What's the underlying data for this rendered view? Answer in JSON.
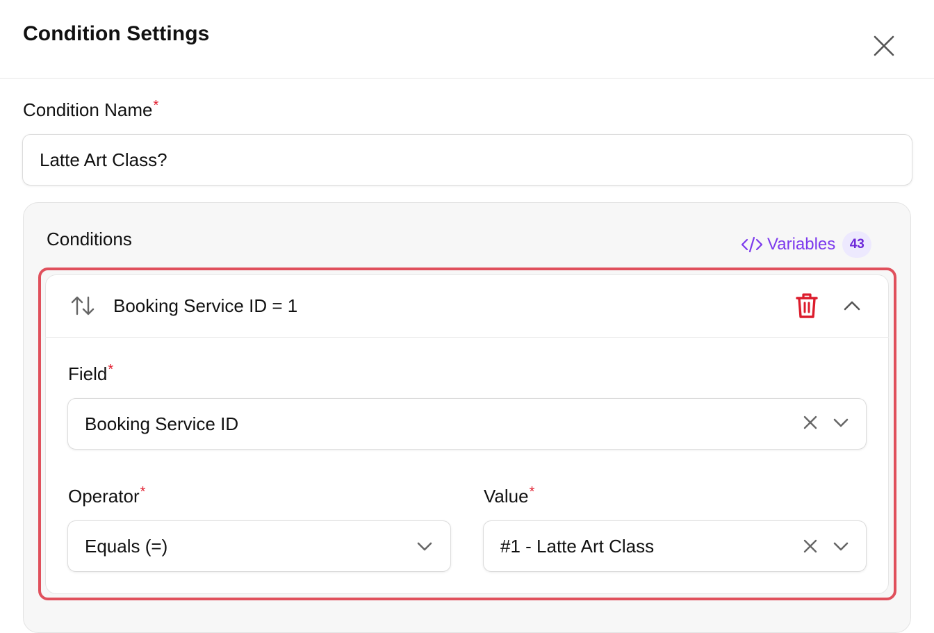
{
  "dialog": {
    "title": "Condition Settings"
  },
  "condition_name": {
    "label": "Condition Name",
    "required_mark": "*",
    "value": "Latte Art Class?"
  },
  "conditions": {
    "label": "Conditions",
    "variables_label": "Variables",
    "variables_count": "43",
    "rule": {
      "summary": "Booking Service ID = 1",
      "field": {
        "label": "Field",
        "required_mark": "*",
        "value": "Booking Service ID"
      },
      "operator": {
        "label": "Operator",
        "required_mark": "*",
        "value": "Equals (=)"
      },
      "value": {
        "label": "Value",
        "required_mark": "*",
        "value": "#1 - Latte Art Class"
      }
    }
  },
  "colors": {
    "accent_purple": "#7c3aed",
    "required_red": "#e11d2e",
    "delete_red": "#dc1c2c",
    "highlight_border": "#e0505c"
  },
  "icons": {
    "close": "close-icon",
    "variables": "code-brackets-icon",
    "sort": "sort-arrows-icon",
    "delete": "trash-icon",
    "collapse": "chevron-up-icon",
    "clear": "clear-x-icon",
    "dropdown": "chevron-down-icon"
  }
}
